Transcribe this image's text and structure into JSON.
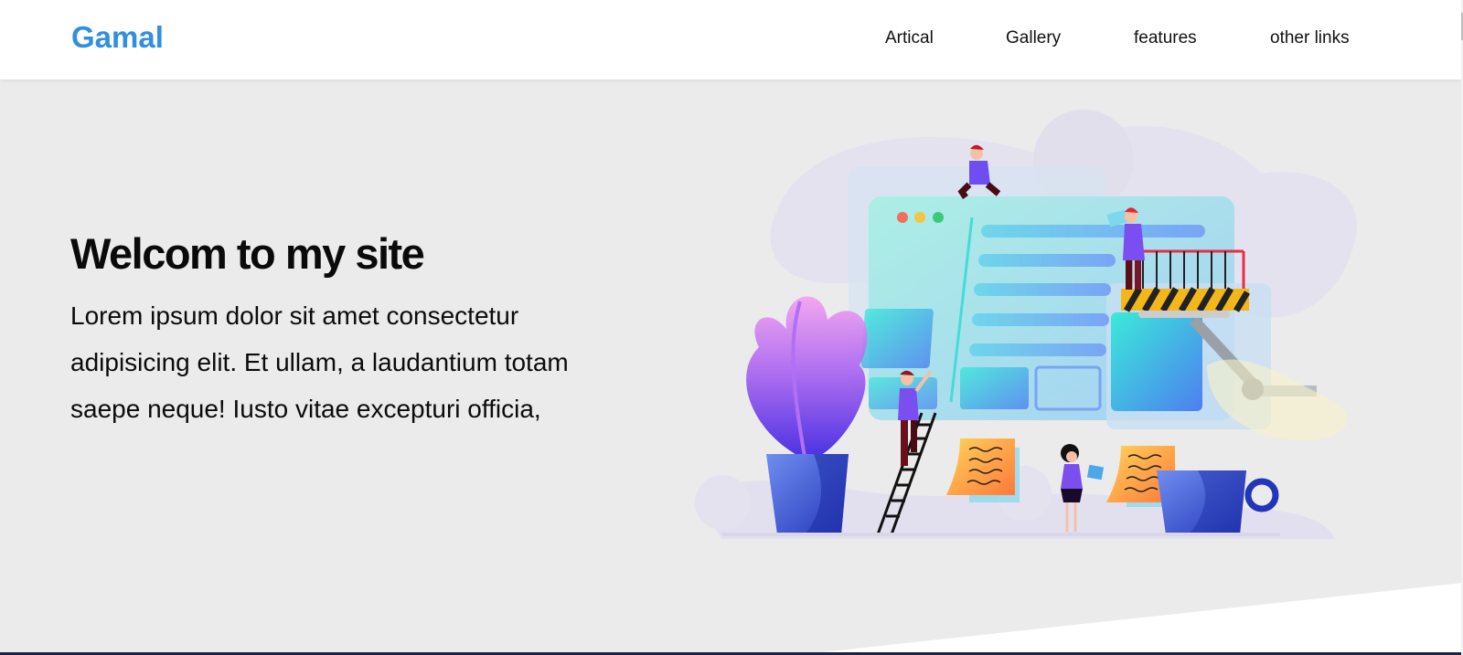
{
  "header": {
    "logo": "Gamal",
    "nav": [
      "Artical",
      "Gallery",
      "features",
      "other links"
    ]
  },
  "hero": {
    "title": "Welcom to my site",
    "text": "Lorem ipsum dolor sit amet consectetur adipisicing elit. Et ullam, a laudantium totam saepe neque! Iusto vitae excepturi officia,"
  },
  "colors": {
    "brand": "#2f8fe0",
    "hero_background": "#ebebeb",
    "header_background": "#ffffff"
  }
}
